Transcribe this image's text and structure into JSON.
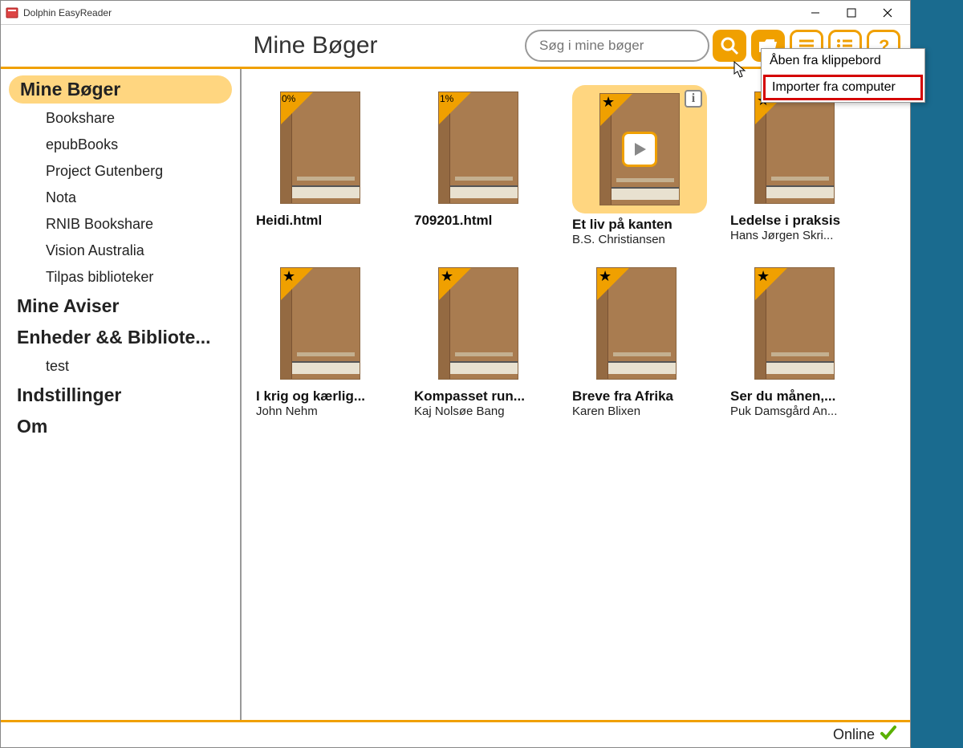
{
  "window": {
    "title": "Dolphin EasyReader"
  },
  "header": {
    "page_title": "Mine Bøger",
    "search_placeholder": "Søg i mine bøger"
  },
  "sidebar": {
    "items": [
      {
        "label": "Mine Bøger",
        "type": "active"
      },
      {
        "label": "Bookshare",
        "type": "sub"
      },
      {
        "label": "epubBooks",
        "type": "sub"
      },
      {
        "label": "Project Gutenberg",
        "type": "sub"
      },
      {
        "label": "Nota",
        "type": "sub"
      },
      {
        "label": "RNIB Bookshare",
        "type": "sub"
      },
      {
        "label": "Vision Australia",
        "type": "sub"
      },
      {
        "label": "Tilpas biblioteker",
        "type": "sub"
      },
      {
        "label": "Mine Aviser",
        "type": "header"
      },
      {
        "label": "Enheder && Bibliote...",
        "type": "header"
      },
      {
        "label": "test",
        "type": "sub"
      },
      {
        "label": "Indstillinger",
        "type": "header"
      },
      {
        "label": "Om",
        "type": "header"
      }
    ]
  },
  "books": [
    {
      "title": "Heidi.html",
      "author": "",
      "badge": "0%",
      "star": false,
      "selected": false,
      "info": false,
      "play": false
    },
    {
      "title": "709201.html",
      "author": "",
      "badge": "1%",
      "star": false,
      "selected": false,
      "info": false,
      "play": false
    },
    {
      "title": "Et liv på kanten",
      "author": "B.S. Christiansen",
      "badge": "",
      "star": true,
      "selected": true,
      "info": true,
      "play": true
    },
    {
      "title": "Ledelse i praksis",
      "author": "Hans Jørgen Skri...",
      "badge": "",
      "star": true,
      "selected": false,
      "info": false,
      "play": false
    },
    {
      "title": "I krig og kærlig...",
      "author": "John Nehm",
      "badge": "",
      "star": true,
      "selected": false,
      "info": false,
      "play": false
    },
    {
      "title": "Kompasset run...",
      "author": "Kaj Nolsøe Bang",
      "badge": "",
      "star": true,
      "selected": false,
      "info": false,
      "play": false
    },
    {
      "title": "Breve fra Afrika",
      "author": "Karen Blixen",
      "badge": "",
      "star": true,
      "selected": false,
      "info": false,
      "play": false
    },
    {
      "title": "Ser du månen,...",
      "author": "Puk Damsgård An...",
      "badge": "",
      "star": true,
      "selected": false,
      "info": false,
      "play": false
    }
  ],
  "dropdown": {
    "items": [
      {
        "label": "Åben fra klippebord",
        "highlighted": false
      },
      {
        "label": "Importer fra computer",
        "highlighted": true
      }
    ]
  },
  "status": {
    "text": "Online"
  },
  "info_glyph": "i"
}
